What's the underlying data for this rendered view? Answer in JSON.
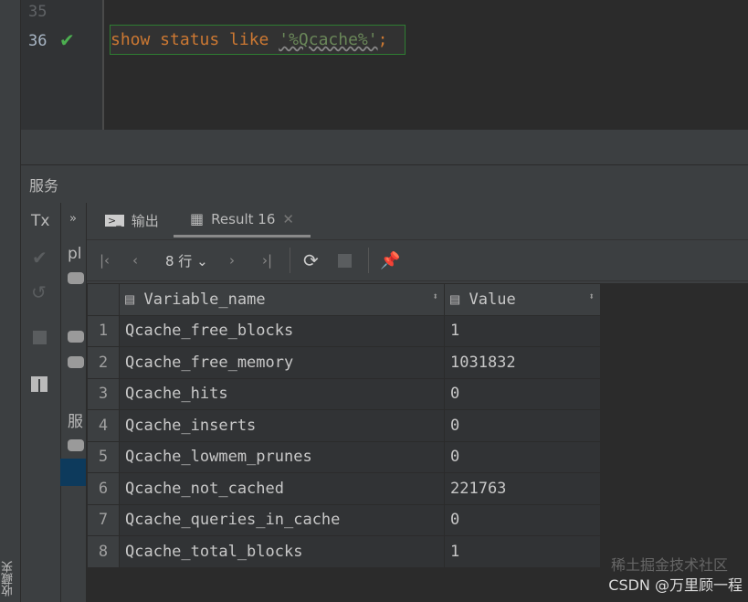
{
  "editor": {
    "lines": [
      {
        "number": "35",
        "code": ""
      },
      {
        "number": "36",
        "status": "success",
        "code_keyword": "show status like ",
        "code_string": "'%Qcache%'",
        "code_end": ";"
      }
    ]
  },
  "services_title": "服务",
  "left_toolbar": {
    "tx_label": "Tx"
  },
  "tree": {
    "item1": "pl",
    "item2": "服"
  },
  "tabs": [
    {
      "label": "输出"
    },
    {
      "label": "Result 16"
    }
  ],
  "toolbar": {
    "rows_label": "8 行"
  },
  "table": {
    "columns": [
      "Variable_name",
      "Value"
    ],
    "rows": [
      {
        "n": "1",
        "name": "Qcache_free_blocks",
        "value": "1"
      },
      {
        "n": "2",
        "name": "Qcache_free_memory",
        "value": "1031832"
      },
      {
        "n": "3",
        "name": "Qcache_hits",
        "value": "0"
      },
      {
        "n": "4",
        "name": "Qcache_inserts",
        "value": "0"
      },
      {
        "n": "5",
        "name": "Qcache_lowmem_prunes",
        "value": "0"
      },
      {
        "n": "6",
        "name": "Qcache_not_cached",
        "value": "221763"
      },
      {
        "n": "7",
        "name": "Qcache_queries_in_cache",
        "value": "0"
      },
      {
        "n": "8",
        "name": "Qcache_total_blocks",
        "value": "1"
      }
    ]
  },
  "side_label": "收藏夹",
  "watermark": "CSDN @万里顾一程",
  "watermark2": "稀土掘金技术社区"
}
